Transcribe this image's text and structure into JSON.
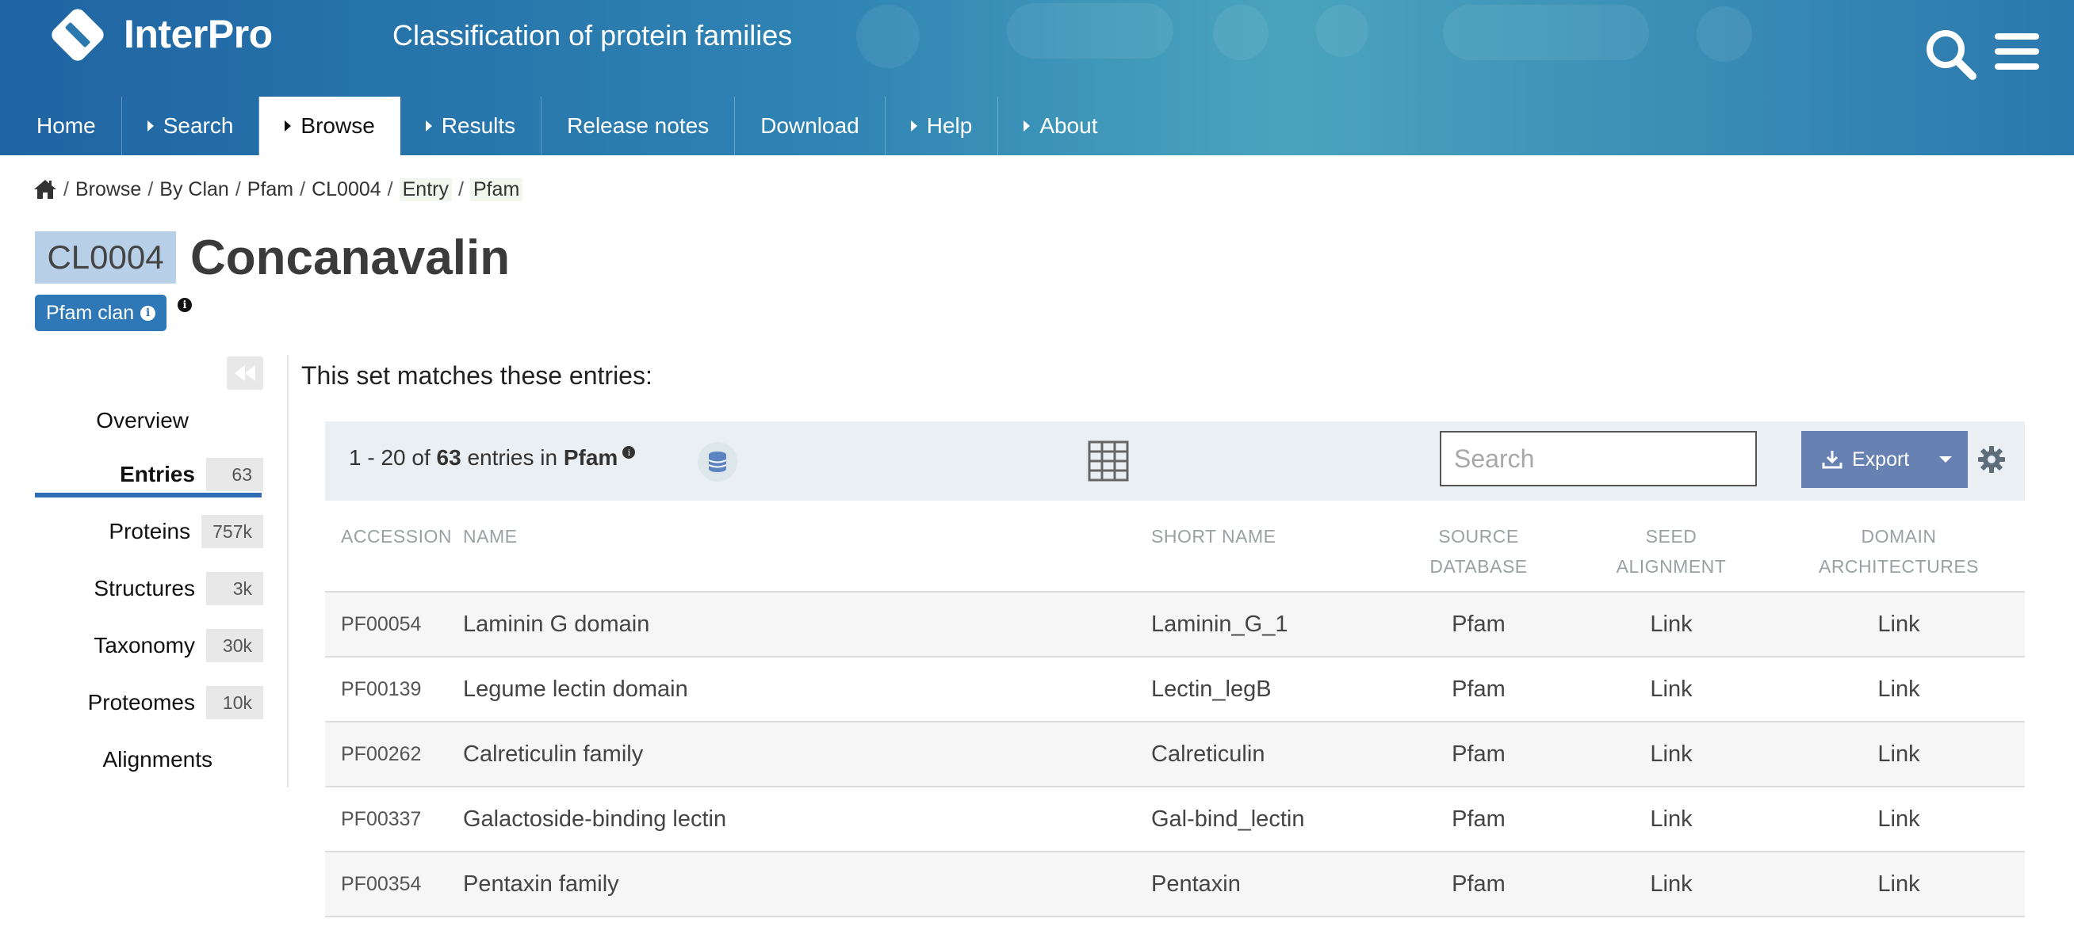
{
  "header": {
    "brand": "InterPro",
    "tagline": "Classification of protein families",
    "nav": [
      {
        "label": "Home",
        "arrow": false
      },
      {
        "label": "Search",
        "arrow": true
      },
      {
        "label": "Browse",
        "arrow": true,
        "active": true
      },
      {
        "label": "Results",
        "arrow": true
      },
      {
        "label": "Release notes",
        "arrow": false
      },
      {
        "label": "Download",
        "arrow": false
      },
      {
        "label": "Help",
        "arrow": true
      },
      {
        "label": "About",
        "arrow": true
      }
    ]
  },
  "breadcrumb": {
    "items": [
      "Browse",
      "By Clan",
      "Pfam",
      "CL0004"
    ],
    "highlight": [
      "Entry",
      "Pfam"
    ]
  },
  "title": {
    "accession": "CL0004",
    "name": "Concanavalin",
    "badge": "Pfam clan"
  },
  "sidebar": {
    "items": [
      {
        "label": "Overview",
        "count": null
      },
      {
        "label": "Entries",
        "count": "63",
        "active": true
      },
      {
        "label": "Proteins",
        "count": "757k"
      },
      {
        "label": "Structures",
        "count": "3k"
      },
      {
        "label": "Taxonomy",
        "count": "30k"
      },
      {
        "label": "Proteomes",
        "count": "10k"
      },
      {
        "label": "Alignments",
        "count": null
      }
    ]
  },
  "main": {
    "heading": "This set matches these entries:",
    "toolbar": {
      "range": "1 - 20 of",
      "total": "63",
      "mid": "entries in",
      "db": "Pfam",
      "search_placeholder": "Search",
      "export_label": "Export"
    },
    "columns": {
      "accession": "Accession",
      "name": "Name",
      "short_name": "Short name",
      "source_1": "Source",
      "source_2": "database",
      "seed_1": "Seed",
      "seed_2": "alignment",
      "arch_1": "Domain",
      "arch_2": "architectures"
    },
    "rows": [
      {
        "accession": "PF00054",
        "name": "Laminin G domain",
        "short": "Laminin_G_1",
        "db": "Pfam",
        "seed": "Link",
        "arch": "Link"
      },
      {
        "accession": "PF00139",
        "name": "Legume lectin domain",
        "short": "Lectin_legB",
        "db": "Pfam",
        "seed": "Link",
        "arch": "Link"
      },
      {
        "accession": "PF00262",
        "name": "Calreticulin family",
        "short": "Calreticulin",
        "db": "Pfam",
        "seed": "Link",
        "arch": "Link"
      },
      {
        "accession": "PF00337",
        "name": "Galactoside-binding lectin",
        "short": "Gal-bind_lectin",
        "db": "Pfam",
        "seed": "Link",
        "arch": "Link"
      },
      {
        "accession": "PF00354",
        "name": "Pentaxin family",
        "short": "Pentaxin",
        "db": "Pfam",
        "seed": "Link",
        "arch": "Link"
      }
    ]
  },
  "colors": {
    "header_dark": "#1f64a3",
    "header_light": "#4aa4bd",
    "accent": "#2e78b8",
    "export": "#6781b2",
    "accession_box": "#b7d0e7"
  },
  "icons": [
    "interpro-logo-icon",
    "search-icon",
    "hamburger-menu-icon",
    "home-icon",
    "collapse-icon",
    "database-icon",
    "grid-view-icon",
    "download-icon",
    "gear-icon",
    "info-icon"
  ]
}
